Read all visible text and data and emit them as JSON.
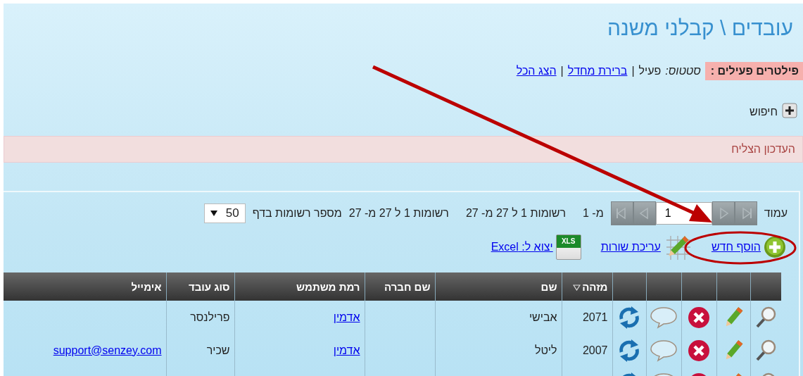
{
  "page": {
    "title": "עובדים \\ קבלני משנה"
  },
  "filters": {
    "label": "פילטרים פעילים :",
    "name": "סטטוס:",
    "value": "פעיל",
    "links": [
      {
        "separator": "|",
        "label": "ברירת מחדל"
      },
      {
        "separator": "|",
        "label": "הצג הכל"
      }
    ]
  },
  "search": {
    "label": "חיפוש",
    "expanded": false
  },
  "message": "העדכון הצליח",
  "pager": {
    "page_label": "עמוד",
    "buttons": [
      {
        "kind": "first",
        "disabled": true
      },
      {
        "kind": "prev",
        "disabled": true
      },
      {
        "kind": "next",
        "disabled": true
      },
      {
        "kind": "last",
        "disabled": true
      }
    ],
    "page": "1",
    "of": "מ- 1",
    "range_texts": [
      "רשומות 1 ל 27 מ- 27",
      "רשומות 1 ל 27 מ- 27"
    ],
    "per_page_label": "מספר רשומות בדף",
    "per_page": "50"
  },
  "actions": [
    {
      "kind": "add",
      "label": "הוסף חדש"
    },
    {
      "kind": "edit_rows",
      "label": "עריכת שורות"
    },
    {
      "kind": "excel",
      "label": "יצוא ל: Excel",
      "icon_text": "XLS"
    }
  ],
  "table": {
    "row_actions": [
      {
        "kind": "view"
      },
      {
        "kind": "edit"
      },
      {
        "kind": "delete"
      },
      {
        "kind": "comment"
      },
      {
        "kind": "refresh"
      }
    ],
    "columns": [
      {
        "label": "מזהה",
        "sorted": true,
        "kind": "text"
      },
      {
        "label": "שם",
        "sorted": false,
        "kind": "text"
      },
      {
        "label": "שם חברה",
        "sorted": false
      },
      {
        "label": "רמת משתמש",
        "sorted": false,
        "kind": "link"
      },
      {
        "label": "סוג עובד",
        "sorted": false,
        "kind": "text"
      },
      {
        "label": "אימייל",
        "sorted": false,
        "kind": "link"
      }
    ],
    "rows": [
      [
        "2071",
        "אבישי",
        null,
        "אדמין",
        "פרילנסר"
      ],
      [
        "2007",
        "ליטל",
        null,
        "אדמין",
        "שכיר",
        "support@senzey.com"
      ],
      []
    ]
  }
}
